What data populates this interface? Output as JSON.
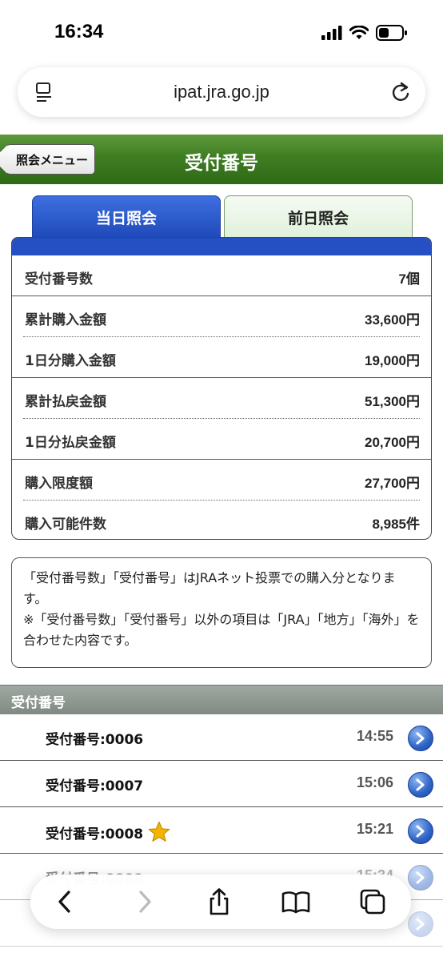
{
  "status_bar": {
    "time": "16:34"
  },
  "browser": {
    "url": "ipat.jra.go.jp"
  },
  "header": {
    "back_label": "照会メニュー",
    "title": "受付番号"
  },
  "tabs": [
    {
      "label": "当日照会",
      "active": true
    },
    {
      "label": "前日照会",
      "active": false
    }
  ],
  "summary": [
    {
      "label": "受付番号数",
      "value": "7",
      "unit": "個"
    },
    {
      "label": "累計購入金額",
      "value": "33,600",
      "unit": "円"
    },
    {
      "label": "1日分購入金額",
      "value": "19,000",
      "unit": "円"
    },
    {
      "label": "累計払戻金額",
      "value": "51,300",
      "unit": "円"
    },
    {
      "label": "1日分払戻金額",
      "value": "20,700",
      "unit": "円"
    },
    {
      "label": "購入限度額",
      "value": "27,700",
      "unit": "円"
    },
    {
      "label": "購入可能件数",
      "value": "8,985",
      "unit": "件"
    }
  ],
  "note": {
    "line1": "「受付番号数」「受付番号」はJRAネット投票での購入分となります。",
    "line2": "※「受付番号数」「受付番号」以外の項目は「JRA」「地方」「海外」を合わせた内容です。"
  },
  "section": {
    "title": "受付番号"
  },
  "receipts": [
    {
      "label": "受付番号:0006",
      "time": "14:55",
      "starred": false
    },
    {
      "label": "受付番号:0007",
      "time": "15:06",
      "starred": false
    },
    {
      "label": "受付番号:0008",
      "time": "15:21",
      "starred": true
    },
    {
      "label": "受付番号:0009",
      "time": "15:34",
      "starred": false
    }
  ],
  "colors": {
    "header_green": "#3f7d22",
    "tab_blue": "#2450c4",
    "arrow_blue": "#2d63c8",
    "star": "#f4b400"
  }
}
